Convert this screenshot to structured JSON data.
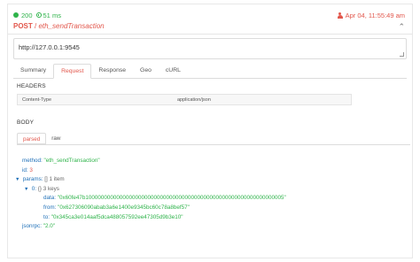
{
  "status": {
    "code": "200",
    "duration": "51 ms"
  },
  "timestamp": "Apr 04, 11:55:49 am",
  "request": {
    "method": "POST",
    "separator": "/",
    "endpoint": "eth_sendTransaction"
  },
  "url": "http://127.0.0.1:9545",
  "tabs": [
    "Summary",
    "Request",
    "Response",
    "Geo",
    "cURL"
  ],
  "active_tab": "Request",
  "headers_section": {
    "title": "HEADERS",
    "rows": [
      {
        "name": "Content-Type",
        "value": "application/json"
      }
    ]
  },
  "body_section": {
    "title": "BODY",
    "subtabs": [
      "parsed",
      "raw"
    ]
  },
  "tree": {
    "method_key": "method:",
    "method_val": "\"eth_sendTransaction\"",
    "id_key": "id:",
    "id_val": "3",
    "params_key": "params:",
    "params_meta": "[]  1 item",
    "zero_key": "0:",
    "zero_meta": "{}  3 keys",
    "data_key": "data:",
    "data_val": "\"0x60fe47b1000000000000000000000000000000000000000000000000000000000000005\"",
    "from_key": "from:",
    "from_val": "\"0x627306090abab3a6e1400e9345bc60c78a8bef57\"",
    "to_key": "to:",
    "to_val": "\"0x345ca3e014aaf5dca488057592ee47305d9b3e10\"",
    "jsonrpc_key": "jsonrpc:",
    "jsonrpc_val": "\"2.0\""
  }
}
